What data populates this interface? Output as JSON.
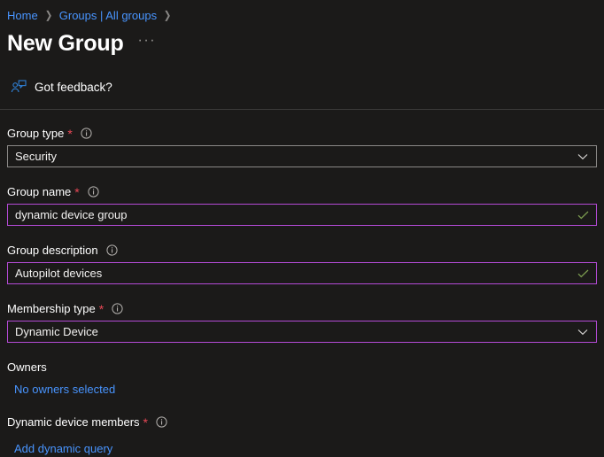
{
  "breadcrumb": {
    "items": [
      {
        "label": "Home",
        "name": "breadcrumb-home"
      },
      {
        "label": "Groups | All groups",
        "name": "breadcrumb-groups-all-groups"
      }
    ],
    "separator": "❯"
  },
  "header": {
    "title": "New Group",
    "more_menu": "···"
  },
  "feedback": {
    "label": "Got feedback?",
    "icon": "feedback-person-icon"
  },
  "form": {
    "group_type": {
      "label": "Group type",
      "required": "*",
      "info_icon": "info-icon",
      "value": "Security",
      "adornment": "chevron-down-icon",
      "focused": false
    },
    "group_name": {
      "label": "Group name",
      "required": "*",
      "info_icon": "info-icon",
      "value": "dynamic device group",
      "placeholder": "Enter a group name",
      "adornment": "check-icon",
      "focused": true
    },
    "group_description": {
      "label": "Group description",
      "required": "",
      "info_icon": "info-icon",
      "value": "Autopilot devices",
      "placeholder": "Enter a group description",
      "adornment": "check-icon",
      "focused": true
    },
    "membership_type": {
      "label": "Membership type",
      "required": "*",
      "info_icon": "info-icon",
      "value": "Dynamic Device",
      "adornment": "chevron-down-icon",
      "focused": true
    },
    "owners": {
      "label": "Owners",
      "link": "No owners selected"
    },
    "dynamic_device_members": {
      "label": "Dynamic device members",
      "required": "*",
      "info_icon": "info-icon",
      "link": "Add dynamic query"
    }
  },
  "colors": {
    "background": "#1b1a19",
    "link": "#4894fe",
    "required_star": "#e74856",
    "focus_border": "#b44bd6",
    "default_border": "#8a8886",
    "valid_check": "#6f8f4a",
    "divider": "#3b3a39"
  }
}
